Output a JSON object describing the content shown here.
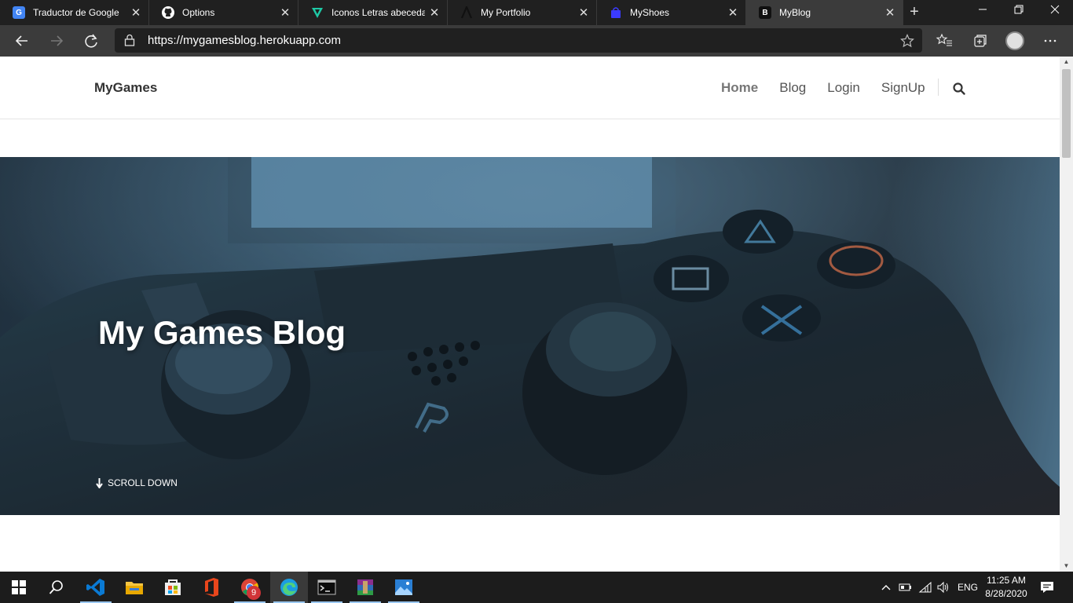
{
  "browser": {
    "tabs": [
      {
        "label": "Traductor de Google",
        "icon": "google-translate-icon",
        "color": "#4285f4"
      },
      {
        "label": "Options",
        "icon": "github-icon",
        "color": "#ffffff"
      },
      {
        "label": "Iconos Letras abecedario",
        "icon": "vuetify-icon",
        "color": "#1ec8a5"
      },
      {
        "label": "My Portfolio",
        "icon": "portfolio-a-icon",
        "color": "#222222"
      },
      {
        "label": "MyShoes",
        "icon": "shopping-bag-icon",
        "color": "#3b3bff"
      },
      {
        "label": "MyBlog",
        "icon": "bootstrap-b-icon",
        "color": "#222222"
      }
    ],
    "tab_glyphs": [
      "G",
      "",
      "V",
      "A",
      "",
      "B"
    ],
    "active_tab": 5,
    "url": "https://mygamesblog.herokuapp.com",
    "close_glyph": "✕",
    "new_tab_glyph": "+"
  },
  "site": {
    "brand": "MyGames",
    "nav": [
      {
        "label": "Home",
        "active": true
      },
      {
        "label": "Blog",
        "active": false
      },
      {
        "label": "Login",
        "active": false
      },
      {
        "label": "SignUp",
        "active": false
      }
    ],
    "hero_title": "My Games Blog",
    "scroll_down": "SCROLL DOWN"
  },
  "taskbar": {
    "apps": [
      "start-icon",
      "search-icon",
      "vscode-icon",
      "file-explorer-icon",
      "store-icon",
      "office-icon",
      "chrome-icon",
      "edge-icon",
      "terminal-icon",
      "winrar-icon",
      "photos-icon"
    ],
    "chrome_badge": "9",
    "language": "ENG",
    "time": "11:25 AM",
    "date": "8/28/2020"
  }
}
